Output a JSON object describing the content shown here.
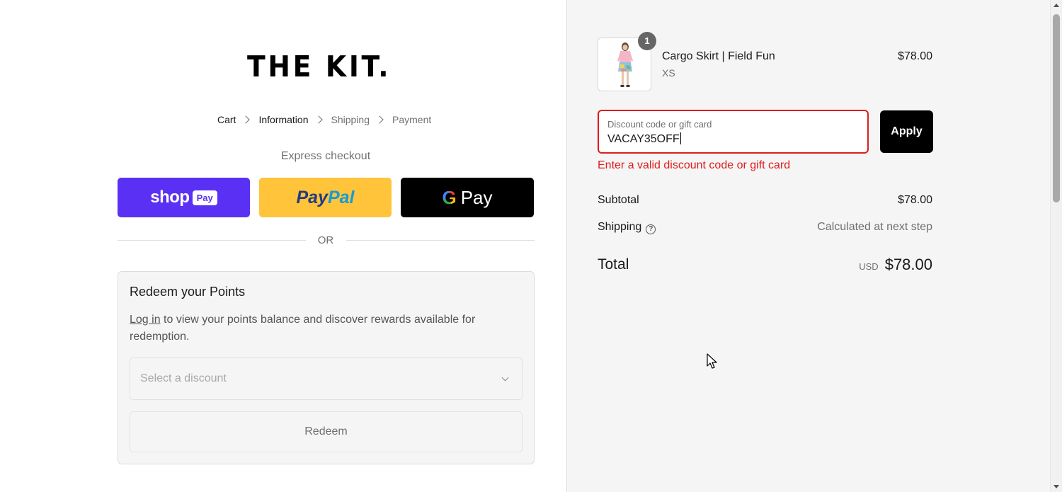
{
  "store": {
    "logo_text": "THE KIT."
  },
  "breadcrumb": [
    {
      "label": "Cart",
      "state": "done"
    },
    {
      "label": "Information",
      "state": "active"
    },
    {
      "label": "Shipping",
      "state": "upcoming"
    },
    {
      "label": "Payment",
      "state": "upcoming"
    }
  ],
  "express_checkout": {
    "title": "Express checkout",
    "shop_pay": {
      "word": "shop",
      "badge": "Pay"
    },
    "paypal": {
      "part1": "Pay",
      "part2": "Pal"
    },
    "google_pay": {
      "g": "G",
      "word": "Pay"
    },
    "or_label": "OR"
  },
  "redeem": {
    "title": "Redeem your Points",
    "login_link": "Log in",
    "description_rest": " to view your points balance and discover rewards available for redemption.",
    "select_placeholder": "Select a discount",
    "redeem_button": "Redeem"
  },
  "order": {
    "item": {
      "name": "Cargo Skirt | Field Fun",
      "variant": "XS",
      "price": "$78.00",
      "quantity": "1"
    },
    "discount": {
      "label": "Discount code or gift card",
      "value": "VACAY35OFF",
      "apply_label": "Apply",
      "error": "Enter a valid discount code or gift card"
    },
    "subtotal": {
      "label": "Subtotal",
      "value": "$78.00"
    },
    "shipping": {
      "label": "Shipping",
      "value": "Calculated at next step",
      "help_icon": "?"
    },
    "total": {
      "label": "Total",
      "currency": "USD",
      "value": "$78.00"
    }
  },
  "colors": {
    "shop_pay": "#5a31f4",
    "paypal": "#ffc439",
    "error": "#dd1d1d",
    "apply": "#000000"
  }
}
